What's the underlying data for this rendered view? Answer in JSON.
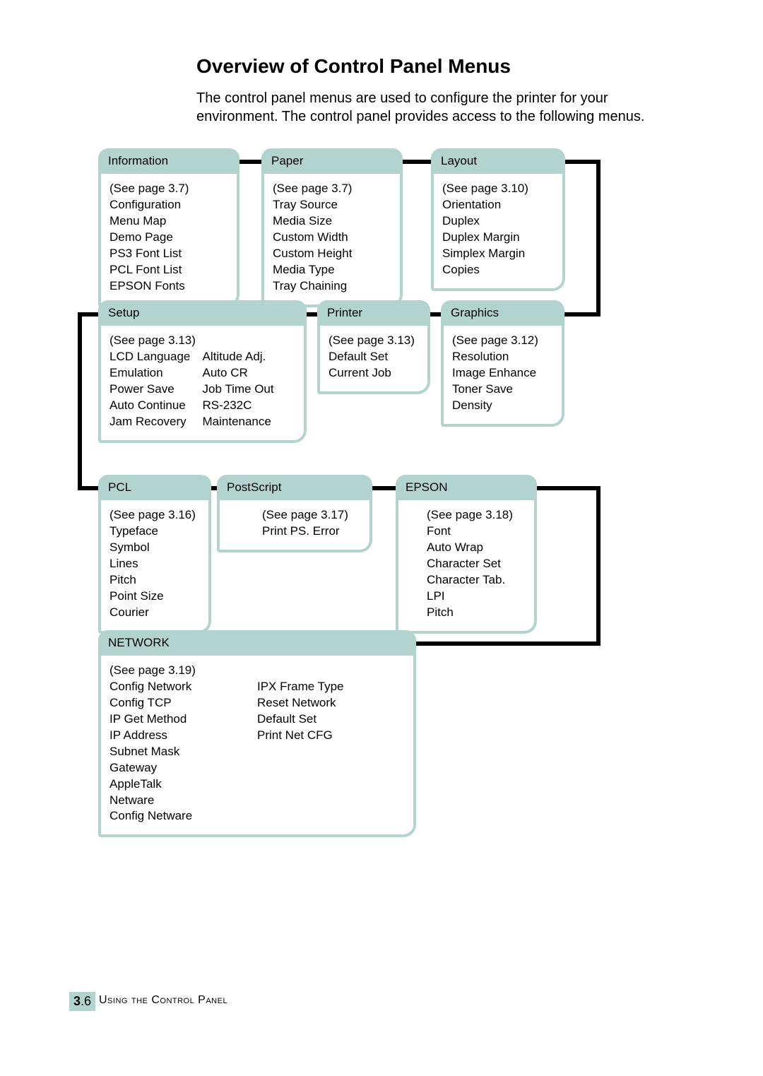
{
  "title": "Overview of Control Panel Menus",
  "intro": "The control panel menus are used to configure the printer for your environment. The control panel provides access to the following menus.",
  "footer": {
    "chapter": "3",
    "page": "6",
    "label": "Using the Control Panel"
  },
  "menus": {
    "information": {
      "title": "Information",
      "ref": "(See page 3.7)",
      "items": [
        "Configuration",
        "Menu Map",
        "Demo Page",
        "PS3 Font List",
        "PCL Font List",
        "EPSON Fonts"
      ]
    },
    "paper": {
      "title": "Paper",
      "ref": "(See page 3.7)",
      "items": [
        "Tray Source",
        "Media Size",
        "Custom Width",
        "Custom Height",
        "Media Type",
        "Tray Chaining"
      ]
    },
    "layout": {
      "title": "Layout",
      "ref": "(See page 3.10)",
      "items": [
        "Orientation",
        "Duplex",
        "Duplex Margin",
        "Simplex Margin",
        "Copies"
      ]
    },
    "setup": {
      "title": "Setup",
      "ref": "(See page 3.13)",
      "col1": [
        "LCD Language",
        "Emulation",
        "Power Save",
        "Auto Continue",
        "Jam Recovery"
      ],
      "col2": [
        "Altitude Adj.",
        "Auto CR",
        "Job Time Out",
        "RS-232C",
        "Maintenance"
      ]
    },
    "printer": {
      "title": "Printer",
      "ref": "(See page 3.13)",
      "items": [
        "Default Set",
        "Current Job"
      ]
    },
    "graphics": {
      "title": "Graphics",
      "ref": "(See page 3.12)",
      "items": [
        "Resolution",
        "Image Enhance",
        "Toner Save",
        "Density"
      ]
    },
    "pcl": {
      "title": "PCL",
      "ref": "(See page 3.16)",
      "items": [
        "Typeface",
        "Symbol",
        "Lines",
        "Pitch",
        "Point Size",
        "Courier"
      ]
    },
    "postscript": {
      "title": "PostScript",
      "ref": "(See page 3.17)",
      "items": [
        "Print PS. Error"
      ]
    },
    "epson": {
      "title": "EPSON",
      "ref": "(See page 3.18)",
      "items": [
        "Font",
        "Auto Wrap",
        "Character Set",
        "Character Tab.",
        "LPI",
        "Pitch"
      ]
    },
    "network": {
      "title": "NETWORK",
      "ref": "(See page 3.19)",
      "col1": [
        "Config Network",
        "Config TCP",
        "IP Get Method",
        "IP Address",
        "Subnet Mask",
        "Gateway",
        "AppleTalk",
        "Netware",
        "Config Netware"
      ],
      "col2": [
        "IPX Frame Type",
        "Reset Network",
        "Default Set",
        "Print Net CFG"
      ]
    }
  }
}
